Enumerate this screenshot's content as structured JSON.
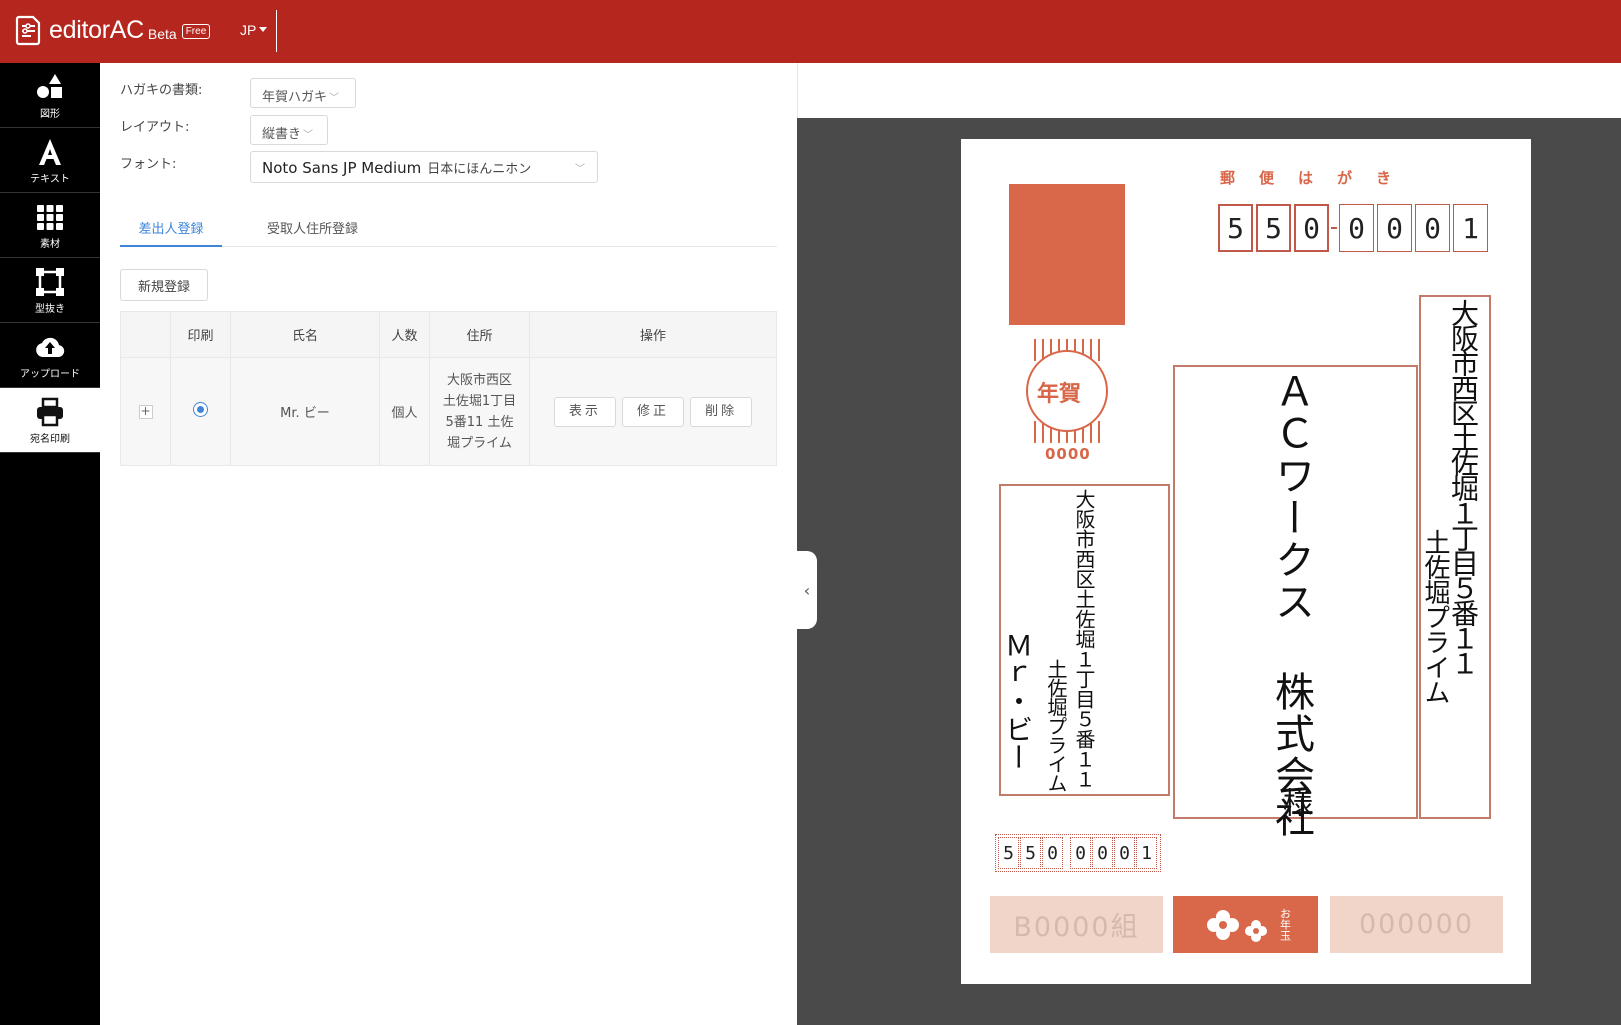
{
  "header": {
    "app_name": "editorAC",
    "beta_label": "Beta",
    "free_badge": "Free",
    "language": "JP",
    "colors": {
      "header_bg": "#b5261e",
      "accent_blue": "#3f86d8",
      "postcard_orange": "#d8674a"
    }
  },
  "sidebar": {
    "items": [
      {
        "label": "図形",
        "icon": "shapes-icon"
      },
      {
        "label": "テキスト",
        "icon": "text-a-icon"
      },
      {
        "label": "素材",
        "icon": "grid-icon"
      },
      {
        "label": "型抜き",
        "icon": "crop-frame-icon"
      },
      {
        "label": "アップロード",
        "icon": "cloud-upload-icon"
      },
      {
        "label": "宛名印刷",
        "icon": "printer-icon",
        "active": true
      }
    ]
  },
  "form": {
    "card_type_label": "ハガキの書類:",
    "card_type_value": "年賀ハガキ",
    "layout_label": "レイアウト:",
    "layout_value": "縦書き",
    "font_label": "フォント:",
    "font_value": "Noto Sans JP Medium",
    "font_sample": "日本にほんニホン"
  },
  "tabs": [
    {
      "label": "差出人登録",
      "active": true
    },
    {
      "label": "受取人住所登録",
      "active": false
    }
  ],
  "new_button": "新規登録",
  "table": {
    "headers": [
      "",
      "印刷",
      "氏名",
      "人数",
      "住所",
      "操作"
    ],
    "rows": [
      {
        "expand": "+",
        "print_selected": true,
        "name": "Mr. ビー",
        "count": "個人",
        "address_lines": [
          "大阪市西区",
          "土佐堀1丁目",
          "5番11 土佐",
          "堀プライム"
        ],
        "actions": [
          "表示",
          "修正",
          "削除"
        ]
      }
    ]
  },
  "postcard": {
    "title": "郵便はがき",
    "zip_top": [
      "5",
      "5",
      "0",
      "0",
      "0",
      "0",
      "1"
    ],
    "postmark_label": "年賀",
    "postmark_number": "0000",
    "recipient_address_line1": "大阪市西区土佐堀１丁目５番１１",
    "recipient_address_line2": "土佐堀プライム",
    "recipient_name": "ＡＣワークス 株式会社",
    "recipient_honorific": "様",
    "sender_address_line1": "大阪市西区土佐堀１丁目５番１１",
    "sender_address_line2": "土佐堀プライム",
    "sender_name": "Ｍｒ・ビー",
    "zip_bottom": [
      "5",
      "5",
      "0",
      "0",
      "0",
      "0",
      "1"
    ],
    "lot_left": "B0000組",
    "lot_mid_label": "お年玉",
    "lot_right": "000000"
  }
}
